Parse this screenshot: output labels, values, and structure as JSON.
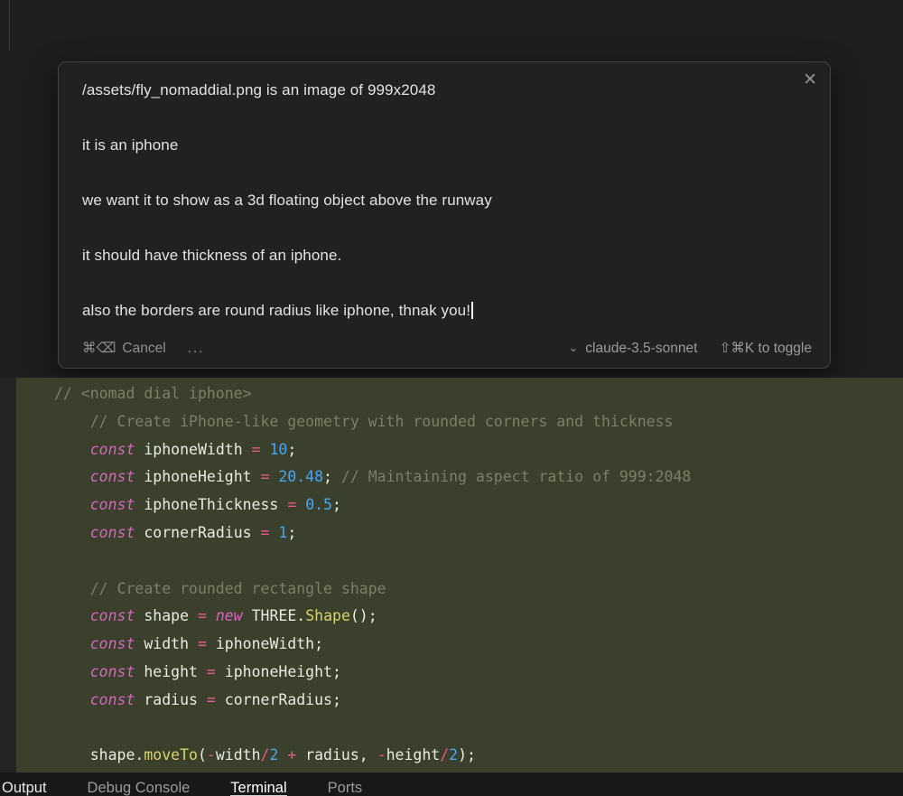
{
  "dialog": {
    "close_icon": "✕",
    "lines": [
      "/assets/fly_nomaddial.png is an image of 999x2048",
      "it is an iphone",
      "we want it to show as a 3d floating object above the runway",
      "it should have thickness of an iphone.",
      "also the borders are round radius like iphone, thnak you!"
    ],
    "footer": {
      "cancel_shortcut": "⌘⌫",
      "cancel_label": "Cancel",
      "more_label": "...",
      "model_chevron": "⌄",
      "model_name": "claude-3.5-sonnet",
      "toggle_hint": "⇧⌘K to toggle"
    }
  },
  "code": {
    "lines": [
      [
        [
          "cm",
          "// <nomad dial iphone>"
        ]
      ],
      [
        [
          "cm",
          "    // Create iPhone-like geometry with rounded corners and thickness"
        ]
      ],
      [
        [
          "pl",
          "    "
        ],
        [
          "kw",
          "const"
        ],
        [
          "pl",
          " iphoneWidth "
        ],
        [
          "op",
          "="
        ],
        [
          "pl",
          " "
        ],
        [
          "num",
          "10"
        ],
        [
          "pl",
          ";"
        ]
      ],
      [
        [
          "pl",
          "    "
        ],
        [
          "kw",
          "const"
        ],
        [
          "pl",
          " iphoneHeight "
        ],
        [
          "op",
          "="
        ],
        [
          "pl",
          " "
        ],
        [
          "num",
          "20.48"
        ],
        [
          "pl",
          "; "
        ],
        [
          "cm",
          "// Maintaining aspect ratio of 999:2048"
        ]
      ],
      [
        [
          "pl",
          "    "
        ],
        [
          "kw",
          "const"
        ],
        [
          "pl",
          " iphoneThickness "
        ],
        [
          "op",
          "="
        ],
        [
          "pl",
          " "
        ],
        [
          "num",
          "0.5"
        ],
        [
          "pl",
          ";"
        ]
      ],
      [
        [
          "pl",
          "    "
        ],
        [
          "kw",
          "const"
        ],
        [
          "pl",
          " cornerRadius "
        ],
        [
          "op",
          "="
        ],
        [
          "pl",
          " "
        ],
        [
          "num",
          "1"
        ],
        [
          "pl",
          ";"
        ]
      ],
      [],
      [
        [
          "cm",
          "    // Create rounded rectangle shape"
        ]
      ],
      [
        [
          "pl",
          "    "
        ],
        [
          "kw",
          "const"
        ],
        [
          "pl",
          " shape "
        ],
        [
          "op",
          "="
        ],
        [
          "pl",
          " "
        ],
        [
          "kw",
          "new"
        ],
        [
          "pl",
          " THREE."
        ],
        [
          "fn",
          "Shape"
        ],
        [
          "pl",
          "();"
        ]
      ],
      [
        [
          "pl",
          "    "
        ],
        [
          "kw",
          "const"
        ],
        [
          "pl",
          " width "
        ],
        [
          "op",
          "="
        ],
        [
          "pl",
          " iphoneWidth;"
        ]
      ],
      [
        [
          "pl",
          "    "
        ],
        [
          "kw",
          "const"
        ],
        [
          "pl",
          " height "
        ],
        [
          "op",
          "="
        ],
        [
          "pl",
          " iphoneHeight;"
        ]
      ],
      [
        [
          "pl",
          "    "
        ],
        [
          "kw",
          "const"
        ],
        [
          "pl",
          " radius "
        ],
        [
          "op",
          "="
        ],
        [
          "pl",
          " cornerRadius;"
        ]
      ],
      [],
      [
        [
          "pl",
          "    shape."
        ],
        [
          "fn",
          "moveTo"
        ],
        [
          "pl",
          "("
        ],
        [
          "op",
          "-"
        ],
        [
          "pl",
          "width"
        ],
        [
          "op",
          "/"
        ],
        [
          "num",
          "2"
        ],
        [
          "pl",
          " "
        ],
        [
          "op",
          "+"
        ],
        [
          "pl",
          " radius, "
        ],
        [
          "op",
          "-"
        ],
        [
          "pl",
          "height"
        ],
        [
          "op",
          "/"
        ],
        [
          "num",
          "2"
        ],
        [
          "pl",
          ");"
        ]
      ]
    ]
  },
  "panel": {
    "tabs": [
      {
        "label": "Output",
        "active": false,
        "dim": false
      },
      {
        "label": "Debug Console",
        "active": false,
        "dim": true
      },
      {
        "label": "Terminal",
        "active": true,
        "dim": false
      },
      {
        "label": "Ports",
        "active": false,
        "dim": true
      }
    ]
  },
  "colors": {
    "editor_background": "#1e1e1e",
    "code_highlight_background": "#3b402d",
    "dialog_background": "#1f2122",
    "keyword": "#d466be",
    "operator": "#f1558b",
    "number": "#46a6f5",
    "function": "#d9d36b",
    "comment": "#7a7f68",
    "plain_text": "#e8eadf"
  }
}
